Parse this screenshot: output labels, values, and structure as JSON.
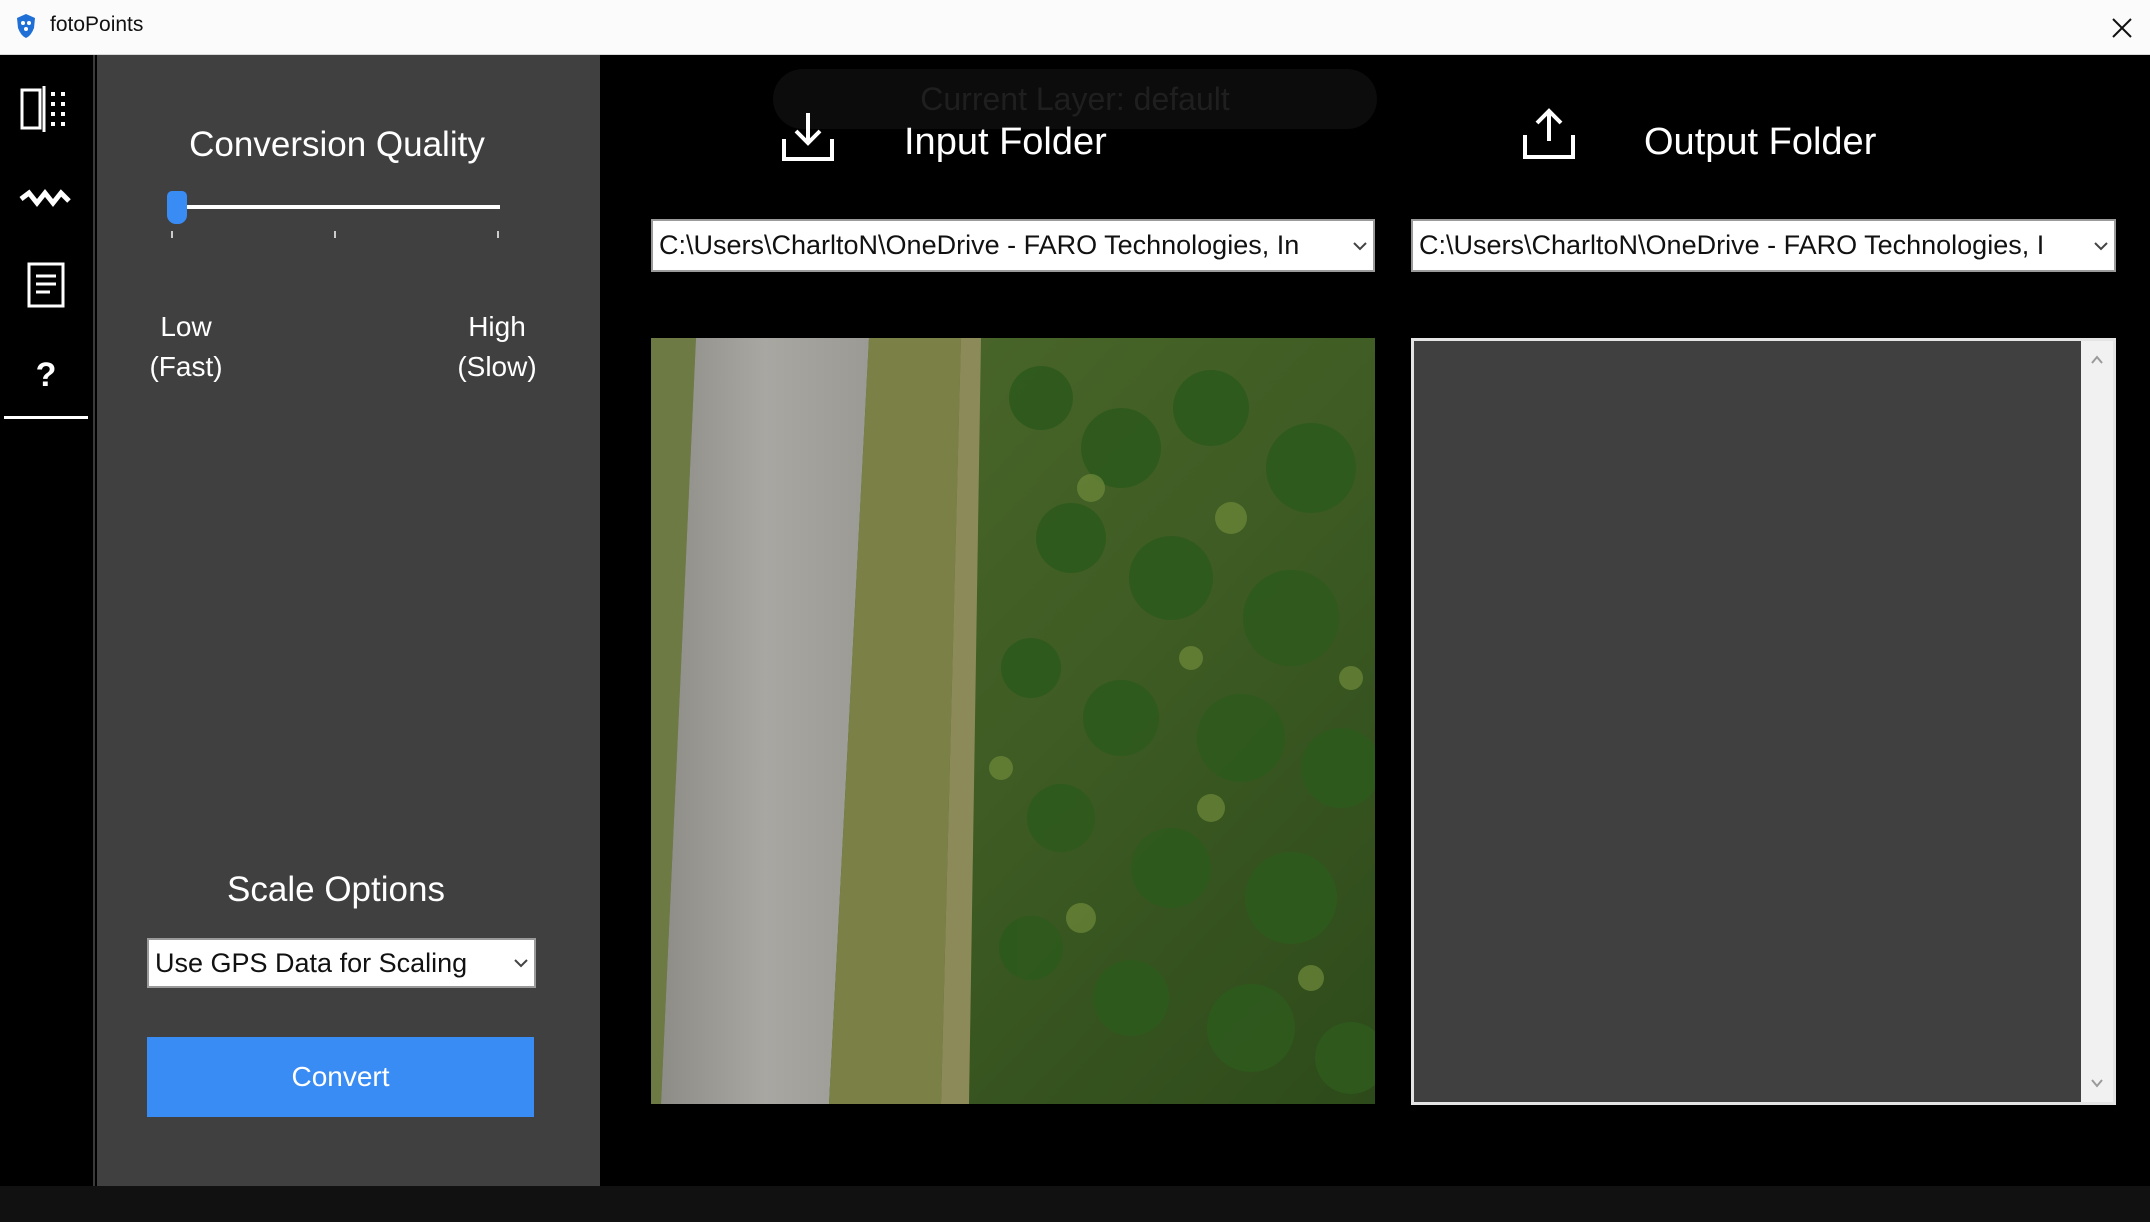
{
  "window": {
    "title": "fotoPoints",
    "close_glyph": "✕"
  },
  "rail": {
    "items": [
      {
        "icon": "split-view-icon"
      },
      {
        "icon": "wave-icon"
      },
      {
        "icon": "document-icon"
      },
      {
        "icon": "help-icon",
        "label": "?"
      }
    ]
  },
  "panel": {
    "quality_title": "Conversion Quality",
    "quality_value": 0.0,
    "low_label_line1": "Low",
    "low_label_line2": "(Fast)",
    "high_label_line1": "High",
    "high_label_line2": "(Slow)",
    "scale_title": "Scale Options",
    "scale_selected": "Use GPS Data for Scaling",
    "convert_label": "Convert"
  },
  "main": {
    "layer_pill": "Current Layer: default",
    "input_title": "Input Folder",
    "output_title": "Output Folder",
    "input_path": "C:\\Users\\CharltoN\\OneDrive - FARO Technologies, In",
    "output_path": "C:\\Users\\CharltoN\\OneDrive - FARO Technologies, I"
  },
  "colors": {
    "accent": "#3a8cf5",
    "panel": "#404040",
    "background": "#000000"
  }
}
